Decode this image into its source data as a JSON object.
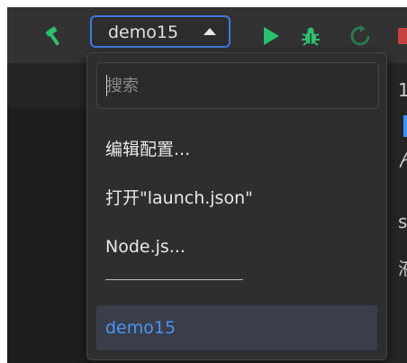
{
  "toolbar": {
    "build_icon": "hammer-icon",
    "run_icon": "play-icon",
    "debug_icon": "bug-icon",
    "restart_icon": "restart-icon",
    "stop_icon": "stop-icon",
    "config_selector": {
      "value": "demo15",
      "caret_icon": "triangle-up-icon"
    }
  },
  "dropdown": {
    "search": {
      "placeholder": "搜索",
      "value": ""
    },
    "items": [
      {
        "label": "编辑配置..."
      },
      {
        "label": "打开\"launch.json\""
      },
      {
        "label": "Node.js..."
      }
    ],
    "separator": "——————",
    "selected_item": {
      "label": "demo15"
    }
  },
  "colors": {
    "accent_green": "#2bc16e",
    "accent_blue": "#3794ff",
    "selected_text": "#4a95f5",
    "stop_red": "#c7423f"
  }
}
